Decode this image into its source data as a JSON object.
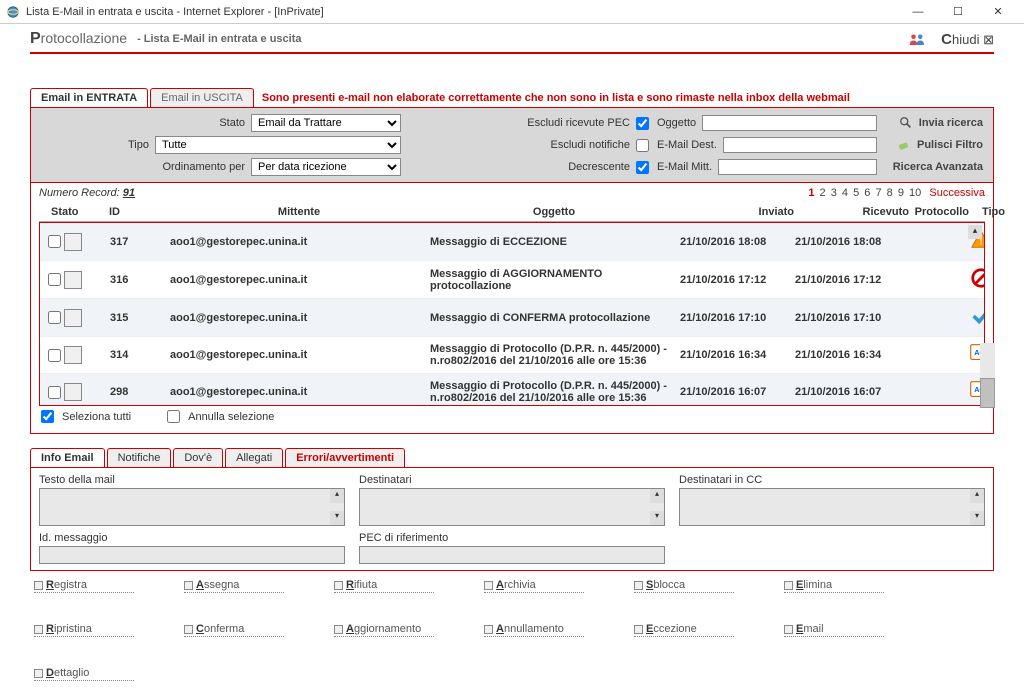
{
  "window": {
    "title": "Lista E-Mail in entrata e uscita - Internet Explorer - [InPrivate]"
  },
  "header": {
    "app": "Protocollazione",
    "sub": "- Lista E-Mail in entrata e uscita",
    "close": "Chiudi"
  },
  "tabs": {
    "in": "Email in ENTRATA",
    "out": "Email in USCITA",
    "warn": "Sono presenti e-mail non elaborate correttamente che non sono in lista e sono rimaste nella inbox della webmail"
  },
  "filters": {
    "stato_label": "Stato",
    "stato_value": "Email da Trattare",
    "tipo_label": "Tipo",
    "tipo_value": "Tutte",
    "ord_label": "Ordinamento per",
    "ord_value": "Per data ricezione",
    "escludi_pec": "Escludi ricevute PEC",
    "oggetto": "Oggetto",
    "escludi_notif": "Escludi notifiche",
    "email_dest": "E-Mail Dest.",
    "decrescente": "Decrescente",
    "email_mitt": "E-Mail Mitt.",
    "invia": "Invia ricerca",
    "pulisci": "Pulisci Filtro",
    "avanzata": "Ricerca Avanzata"
  },
  "records": {
    "label": "Numero Record:",
    "count": "91",
    "pages": [
      "1",
      "2",
      "3",
      "4",
      "5",
      "6",
      "7",
      "8",
      "9",
      "10"
    ],
    "next": "Successiva"
  },
  "cols": {
    "stato": "Stato",
    "id": "ID",
    "mitt": "Mittente",
    "ogg": "Oggetto",
    "inv": "Inviato",
    "ric": "Ricevuto",
    "prot": "Protocollo",
    "tipo": "Tipo"
  },
  "rows": [
    {
      "id": "317",
      "mitt": "aoo1@gestorepec.unina.it",
      "ogg": "Messaggio di ECCEZIONE",
      "inv": "21/10/2016 18:08",
      "ric": "21/10/2016 18:08",
      "icon": "warn"
    },
    {
      "id": "316",
      "mitt": "aoo1@gestorepec.unina.it",
      "ogg": "Messaggio di AGGIORNAMENTO protocollazione",
      "inv": "21/10/2016 17:12",
      "ric": "21/10/2016 17:12",
      "icon": "deny"
    },
    {
      "id": "315",
      "mitt": "aoo1@gestorepec.unina.it",
      "ogg": "Messaggio di CONFERMA protocollazione",
      "inv": "21/10/2016 17:10",
      "ric": "21/10/2016 17:10",
      "icon": "ok"
    },
    {
      "id": "314",
      "mitt": "aoo1@gestorepec.unina.it",
      "ogg": "Messaggio di Protocollo (D.P.R. n. 445/2000) - n.ro802/2016 del 21/10/2016 alle ore 15:36",
      "inv": "21/10/2016 16:34",
      "ric": "21/10/2016 16:34",
      "icon": "aoo"
    },
    {
      "id": "298",
      "mitt": "aoo1@gestorepec.unina.it",
      "ogg": "Messaggio di Protocollo (D.P.R. n. 445/2000) - n.ro802/2016 del 21/10/2016 alle ore 15:36",
      "inv": "21/10/2016 16:07",
      "ric": "21/10/2016 16:07",
      "icon": "aoo"
    }
  ],
  "sel": {
    "all": "Seleziona tutti",
    "none": "Annulla selezione"
  },
  "dtabs": {
    "info": "Info Email",
    "notif": "Notifiche",
    "dove": "Dov'è",
    "alleg": "Allegati",
    "err": "Errori/avvertimenti"
  },
  "details": {
    "testo": "Testo della mail",
    "idmsg": "Id. messaggio",
    "dest": "Destinatari",
    "pecrif": "PEC di riferimento",
    "destcc": "Destinatari in CC"
  },
  "actions": {
    "registra": "Registra",
    "assegna": "Assegna",
    "rifiuta": "Rifiuta",
    "archivia": "Archivia",
    "sblocca": "Sblocca",
    "elimina": "Elimina",
    "ripristina": "Ripristina",
    "conferma": "Conferma",
    "aggiorn": "Aggiornamento",
    "annull": "Annullamento",
    "eccez": "Eccezione",
    "email": "Email",
    "dettaglio": "Dettaglio"
  }
}
